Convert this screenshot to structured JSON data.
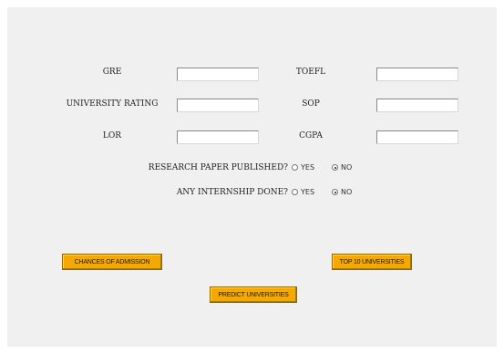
{
  "labels": {
    "gre": "GRE",
    "toefl": "TOEFL",
    "university_rating": "UNIVERSITY RATING",
    "sop": "SOP",
    "lor": "LOR",
    "cgpa": "CGPA"
  },
  "fields": {
    "gre": "",
    "toefl": "",
    "university_rating": "",
    "sop": "",
    "lor": "",
    "cgpa": ""
  },
  "questions": {
    "research": {
      "label": "RESEARCH PAPER PUBLISHED?",
      "yes": "YES",
      "no": "NO",
      "selected": "NO"
    },
    "internship": {
      "label": "ANY INTERNSHIP DONE?",
      "yes": "YES",
      "no": "NO",
      "selected": "NO"
    }
  },
  "buttons": {
    "chances": "CHANCES OF ADMISSION",
    "top10": "TOP 10 UNIVERSITIES",
    "predict": "PREDICT UNIVERSITIES"
  },
  "colors": {
    "button": "#f5a800",
    "panel": "#f0f0f0"
  }
}
